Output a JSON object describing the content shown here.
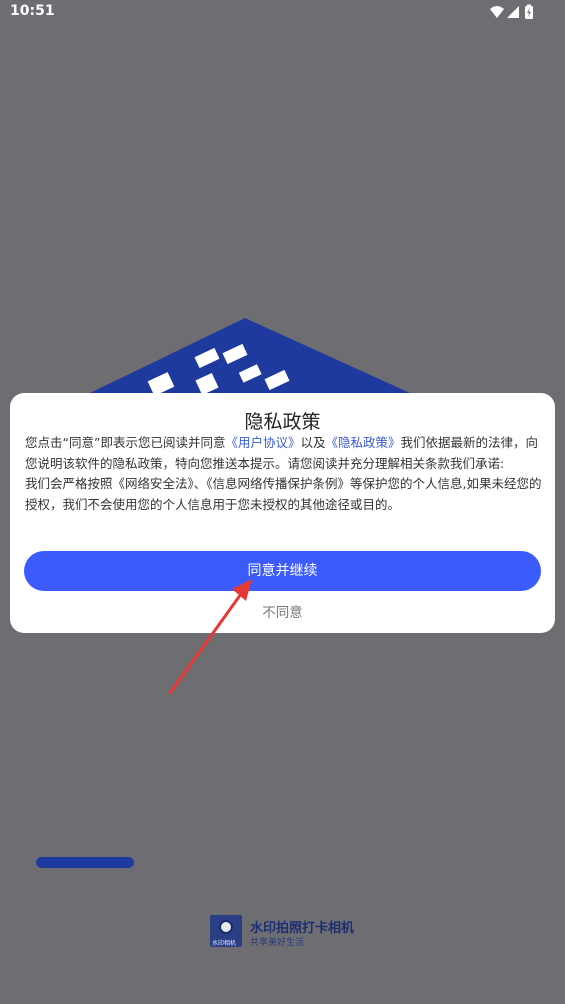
{
  "status_bar": {
    "time": "10:51",
    "icons": [
      "wifi-icon",
      "signal-icon",
      "battery-charging-icon"
    ]
  },
  "background_app": {
    "name": "水印拍照打卡相机",
    "slogan": "共享美好生活",
    "logo_caption": "水印相机"
  },
  "dialog": {
    "title": "隐私政策",
    "body_text_1": "您点击“同意”即表示您已阅读并同意",
    "link_user_agreement": "《用户协议》",
    "body_text_2": "以及",
    "link_privacy_policy": "《隐私政策》",
    "body_text_3": "我们依据最新的法律，向您说明该软件的隐私政策，特向您推送本提示。请您阅读并充分理解相关条款我们承诺:",
    "body_text_4": "我们会严格按照《网络安全法》、《信息网络传播保护条例》等保护您的个人信息,如果未经您的授权，我们不会使用您的个人信息用于您未授权的其他途径或目的。",
    "agree_label": "同意并继续",
    "disagree_label": "不同意"
  },
  "colors": {
    "accent": "#3b5bfd",
    "link": "#3a5bd9",
    "arrow": "#e53935",
    "overlay": "#6e6e72"
  }
}
